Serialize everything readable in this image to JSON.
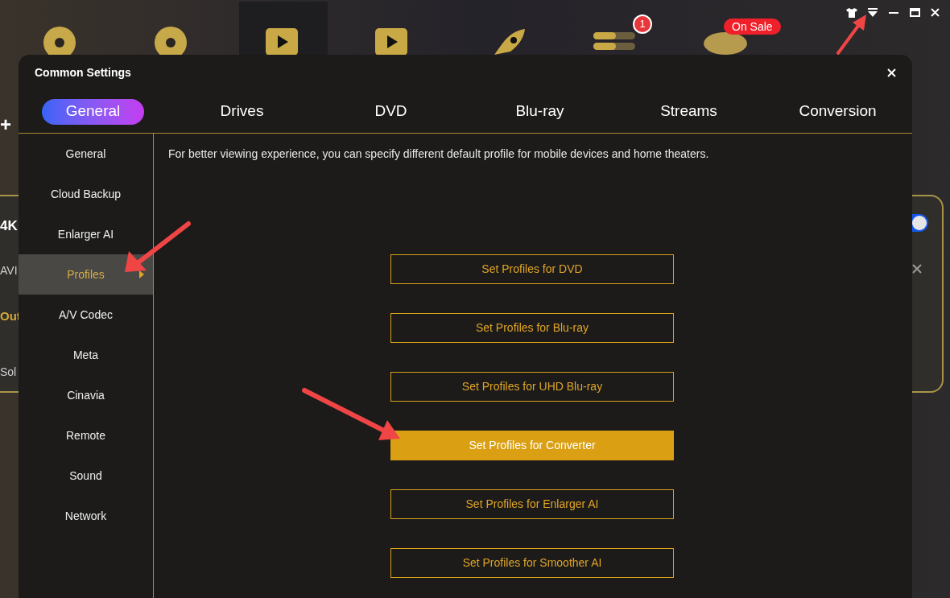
{
  "app": {
    "task_badge": "1",
    "sale_badge": "On Sale",
    "add_mark": "+",
    "card": {
      "texts": [
        {
          "label": "4K",
          "kind": "bold"
        },
        {
          "label": "AVI",
          "kind": "plain"
        },
        {
          "label": "Out",
          "kind": "accent"
        },
        {
          "label": "Sol",
          "kind": "plain"
        }
      ],
      "toggle": {
        "on": true
      }
    }
  },
  "dialog": {
    "title": "Common Settings",
    "tabs": [
      {
        "label": "General",
        "selected": true
      },
      {
        "label": "Drives",
        "selected": false
      },
      {
        "label": "DVD",
        "selected": false
      },
      {
        "label": "Blu-ray",
        "selected": false
      },
      {
        "label": "Streams",
        "selected": false
      },
      {
        "label": "Conversion",
        "selected": false
      }
    ],
    "sidebar": [
      {
        "label": "General",
        "selected": false
      },
      {
        "label": "Cloud Backup",
        "selected": false
      },
      {
        "label": "Enlarger AI",
        "selected": false
      },
      {
        "label": "Profiles",
        "selected": true
      },
      {
        "label": "A/V Codec",
        "selected": false
      },
      {
        "label": "Meta",
        "selected": false
      },
      {
        "label": "Cinavia",
        "selected": false
      },
      {
        "label": "Remote",
        "selected": false
      },
      {
        "label": "Sound",
        "selected": false
      },
      {
        "label": "Network",
        "selected": false
      }
    ],
    "description": "For better viewing experience, you can specify different default profile for mobile devices and home theaters.",
    "buttons": [
      {
        "label": "Set Profiles for DVD",
        "selected": false
      },
      {
        "label": "Set Profiles for Blu-ray",
        "selected": false
      },
      {
        "label": "Set Profiles for UHD Blu-ray",
        "selected": false
      },
      {
        "label": "Set Profiles for Converter",
        "selected": true
      },
      {
        "label": "Set Profiles for Enlarger AI",
        "selected": false
      },
      {
        "label": "Set Profiles for Smoother AI",
        "selected": false
      }
    ]
  }
}
